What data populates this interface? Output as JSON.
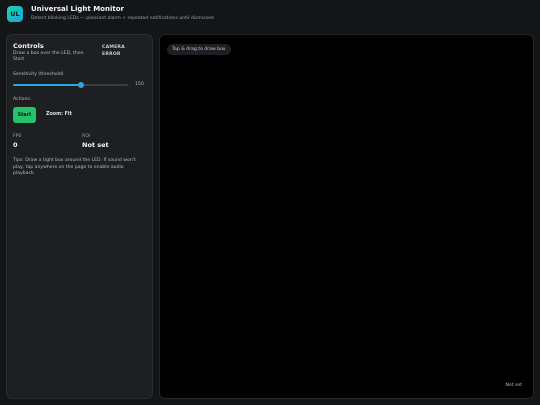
{
  "app": {
    "logo_text": "UL",
    "title": "Universal Light Monitor",
    "subtitle": "Detect blinking LEDs — pleasant alarm + repeated notifications until dismissed"
  },
  "controls": {
    "title": "Controls",
    "help": "Draw a box over the LED, then Start",
    "camera_status": "CAMERA ERROR",
    "sensitivity_label": "Sensitivity (threshold)",
    "sensitivity_value": "150",
    "sensitivity_fraction": 0.59,
    "actions_label": "Actions:",
    "start_label": "Start",
    "zoom_label": "Zoom: Fit",
    "fps_label": "FPS",
    "fps_value": "0",
    "roi_label": "ROI",
    "roi_value": "Not set",
    "tips": "Tips: Draw a tight box around the LED. If sound won't play, tap anywhere on the page to enable audio playback."
  },
  "video": {
    "hint": "Tap & drag to draw box",
    "roi_badge": "Not set"
  },
  "colors": {
    "accent": "#2aa9e0",
    "start": "#23c26b",
    "logo_start": "#1fd3b0",
    "logo_end": "#15a6d6"
  }
}
